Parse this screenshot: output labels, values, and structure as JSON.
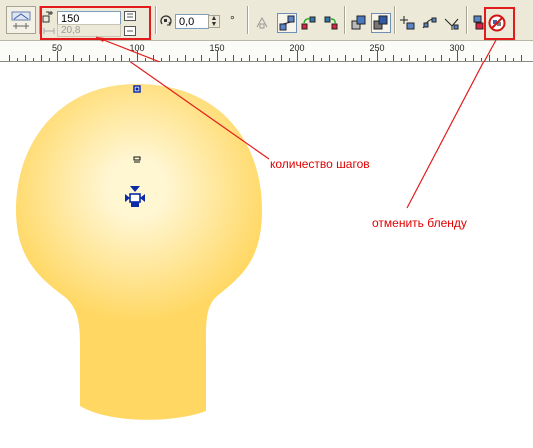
{
  "toolbar": {
    "steps_value": "150",
    "offset_value": "20,8",
    "angle_value": "0,0",
    "angle_unit": "°",
    "rotate_icon": "rotate-icon",
    "clear_blend_icon": "clear-blend-icon"
  },
  "ruler": {
    "labels": [
      "50",
      "100",
      "150",
      "200",
      "250",
      "300"
    ]
  },
  "annotations": {
    "steps_label": "количество шагов",
    "clear_blend_label": "отменить бленду"
  },
  "colors": {
    "annotation": "#e31b1b",
    "bulb_center": "#fff6d2",
    "bulb_edge": "#ffd762",
    "handle": "#0b2aa8"
  }
}
